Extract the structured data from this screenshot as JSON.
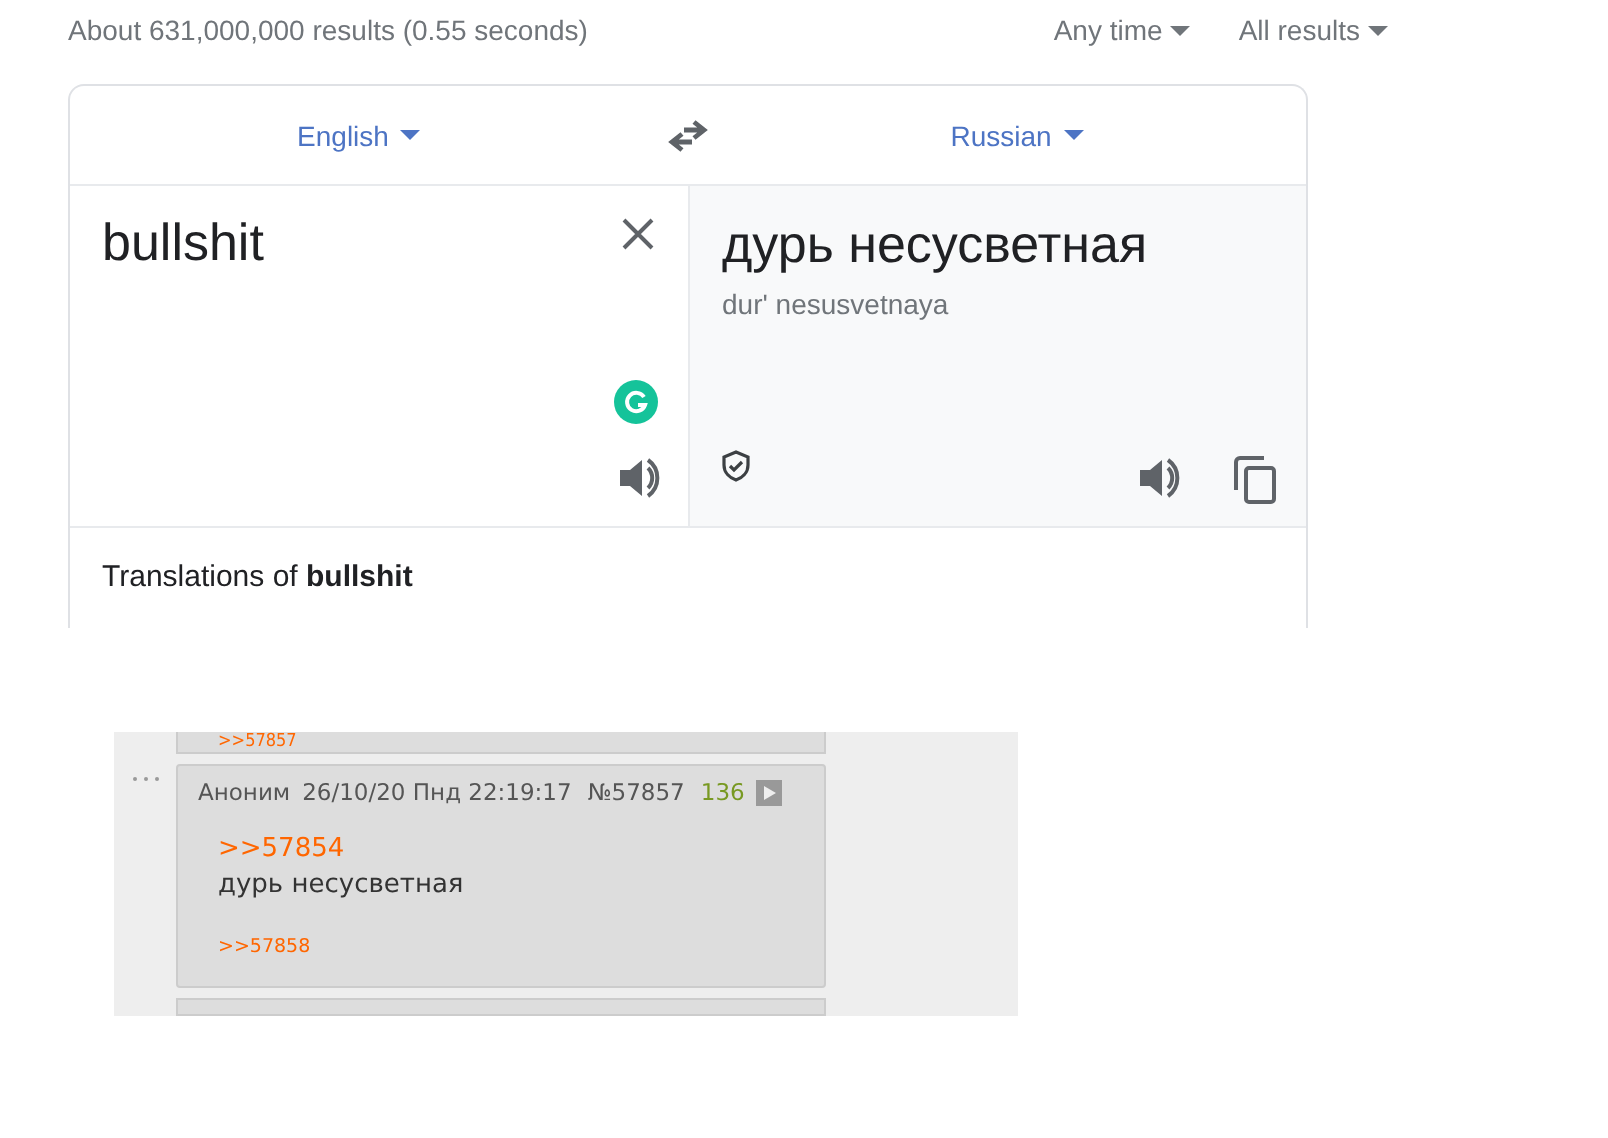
{
  "results_stats": "About 631,000,000 results (0.55 seconds)",
  "filters": [
    {
      "label": "Any time"
    },
    {
      "label": "All results"
    }
  ],
  "translator": {
    "source_language": "English",
    "target_language": "Russian",
    "source_text": "bullshit",
    "translation": "дурь несусветная",
    "transliteration": "dur' nesusvetnaya",
    "footer": "Translations of **bullshit**"
  },
  "forum": {
    "previous_reply_link": ">>57857",
    "post": {
      "author": "Аноним",
      "date": "26/10/20 Пнд 22:19:17",
      "number": "№57857",
      "count": "136",
      "quote_link": ">>57854",
      "text": "дурь несусветная",
      "reply_link": ">>57858"
    }
  }
}
